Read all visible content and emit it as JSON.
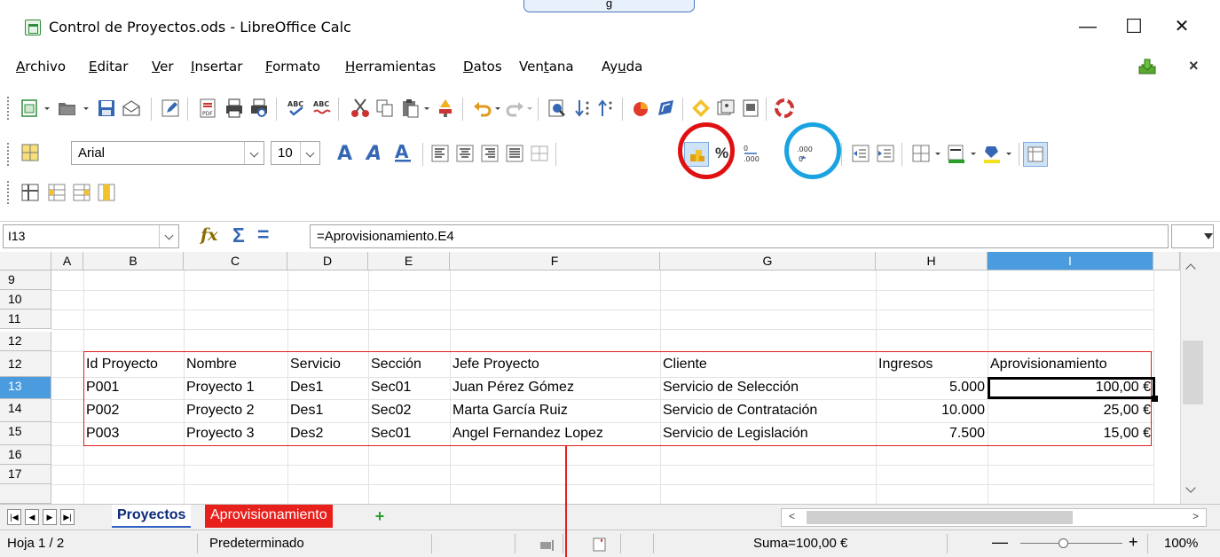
{
  "callout": {
    "label": "g"
  },
  "window": {
    "title": "Control de Proyectos.ods - LibreOffice Calc",
    "minimize": "—",
    "maximize": "☐",
    "close": "✕"
  },
  "menu": {
    "items": [
      "Archivo",
      "Editar",
      "Ver",
      "Insertar",
      "Formato",
      "Herramientas",
      "Datos",
      "Ventana",
      "Ayuda"
    ],
    "underline": [
      "A",
      "E",
      "V",
      "I",
      "F",
      "H",
      "D",
      "t",
      "u"
    ],
    "close_doc": "×"
  },
  "format_toolbar": {
    "font_name": "Arial",
    "font_size": "10",
    "percent_label": "%",
    "decimal_add_label": ".000",
    "decimal_remove_label": ".000"
  },
  "formula_bar": {
    "cell_ref": "I13",
    "function_wizard": "fx",
    "sum_symbol": "Σ",
    "equals_symbol": "=",
    "formula": "=Aprovisionamiento.E4"
  },
  "grid": {
    "columns": [
      "A",
      "B",
      "C",
      "D",
      "E",
      "F",
      "G",
      "H",
      "I"
    ],
    "selected_column": "I",
    "rows": [
      "9",
      "10",
      "11",
      "12",
      "13",
      "14",
      "15",
      "16",
      "17"
    ],
    "selected_row": "13",
    "header_row": [
      "Id Proyecto",
      "Nombre",
      "Servicio",
      "Sección",
      "Jefe Proyecto",
      "Cliente",
      "Ingresos",
      "Aprovisionamiento"
    ],
    "data_rows": [
      [
        "P001",
        "Proyecto 1",
        "Des1",
        "Sec01",
        "Juan Pérez Gómez",
        "Servicio de Selección",
        "5.000",
        "100,00 €"
      ],
      [
        "P002",
        "Proyecto 2",
        "Des1",
        "Sec02",
        "Marta García Ruiz",
        "Servicio de Contratación",
        "10.000",
        "25,00 €"
      ],
      [
        "P003",
        "Proyecto 3",
        "Des2",
        "Sec01",
        "Angel Fernandez Lopez",
        "Servicio de Legislación",
        "7.500",
        "15,00 €"
      ]
    ]
  },
  "sheets": {
    "tabs": [
      "Proyectos",
      "Aprovisionamiento"
    ],
    "active": "Proyectos",
    "add": "+"
  },
  "status": {
    "sheet": "Hoja 1 / 2",
    "style": "Predeterminado",
    "sum": "Suma=100,00 €",
    "zoom": "100%",
    "zoom_minus": "—",
    "zoom_plus": "+"
  },
  "highlights": {
    "currency_circle_color": "#e01010",
    "decimal_circle_color": "#1aa3e0"
  }
}
